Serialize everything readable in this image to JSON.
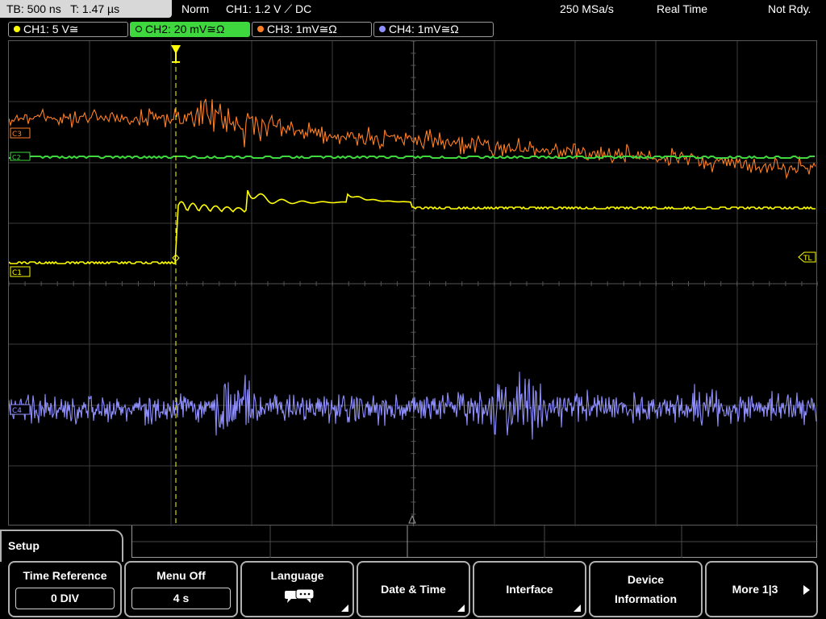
{
  "status_bar": {
    "timebase": "TB: 500 ns",
    "trigger_time": "T: 1.47 µs",
    "mode": "Norm",
    "trigger_info": "CH1: 1.2 V ⟋ DC",
    "sample_rate": "250 MSa/s",
    "acquisition": "Real Time",
    "trigger_state": "Not Rdy."
  },
  "channels": [
    {
      "label": "CH1: 5 V≅",
      "color": "#ffff00"
    },
    {
      "label": "CH2: 20 mV≅Ω",
      "color": "#3ed83e"
    },
    {
      "label": "CH3: 1mV≅Ω",
      "color": "#ff7f27"
    },
    {
      "label": "CH4: 1mV≅Ω",
      "color": "#8f8fff"
    }
  ],
  "plot_markers": {
    "c3": "C3",
    "c2": "C2",
    "c1": "C1",
    "c4": "C4",
    "trigger_level": "TL"
  },
  "menu": {
    "title": "Setup",
    "softkeys": [
      {
        "label": "Time Reference",
        "value": "0 DIV"
      },
      {
        "label": "Menu Off",
        "value": "4 s"
      },
      {
        "label": "Language",
        "icon": "speech-bubbles-icon"
      },
      {
        "label": "Date & Time"
      },
      {
        "label": "Interface"
      },
      {
        "label": "Device Information"
      },
      {
        "label": "More 1|3",
        "icon": "arrow-right-icon"
      }
    ]
  },
  "colors": {
    "ch1": "#ffff00",
    "ch2": "#3ed83e",
    "ch3": "#ff7f27",
    "ch4": "#8f8fff",
    "grid": "#3c3c3c",
    "graticule_border": "#5a5a5a"
  }
}
